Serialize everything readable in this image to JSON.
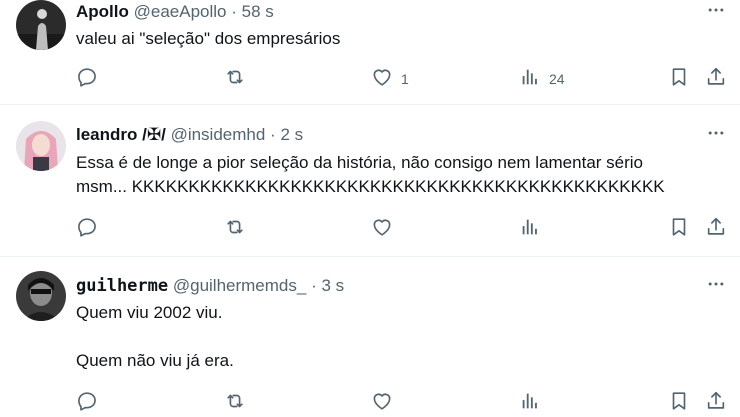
{
  "tweets": [
    {
      "name": "Apollo",
      "handle": "@eaeApollo",
      "separator": "·",
      "time": "58 s",
      "text": "valeu ai \"seleção\" dos empresários",
      "likes": "1",
      "views": "24"
    },
    {
      "name": "leandro /✠/",
      "handle": "@insidemhd",
      "separator": "·",
      "time": "2 s",
      "text": "Essa é de longe a pior seleção da história, não consigo nem lamentar sério\nmsm... KKKKKKKKKKKKKKKKKKKKKKKKKKKKKKKKKKKKKKKKKKKKKKK",
      "likes": "",
      "views": ""
    },
    {
      "name": "guilherme",
      "handle": "@guilhermemds_",
      "separator": "·",
      "time": "3 s",
      "text": "Quem viu 2002 viu.\n\nQuem não viu já era.",
      "likes": "",
      "views": ""
    }
  ],
  "icons": {
    "reply": "reply-icon",
    "retweet": "retweet-icon",
    "like": "like-icon",
    "views": "views-icon",
    "bookmark": "bookmark-icon",
    "share": "share-icon",
    "more": "more-icon"
  },
  "colors": {
    "text": "#0f1419",
    "secondary": "#536471",
    "divider": "#eff3f4"
  }
}
